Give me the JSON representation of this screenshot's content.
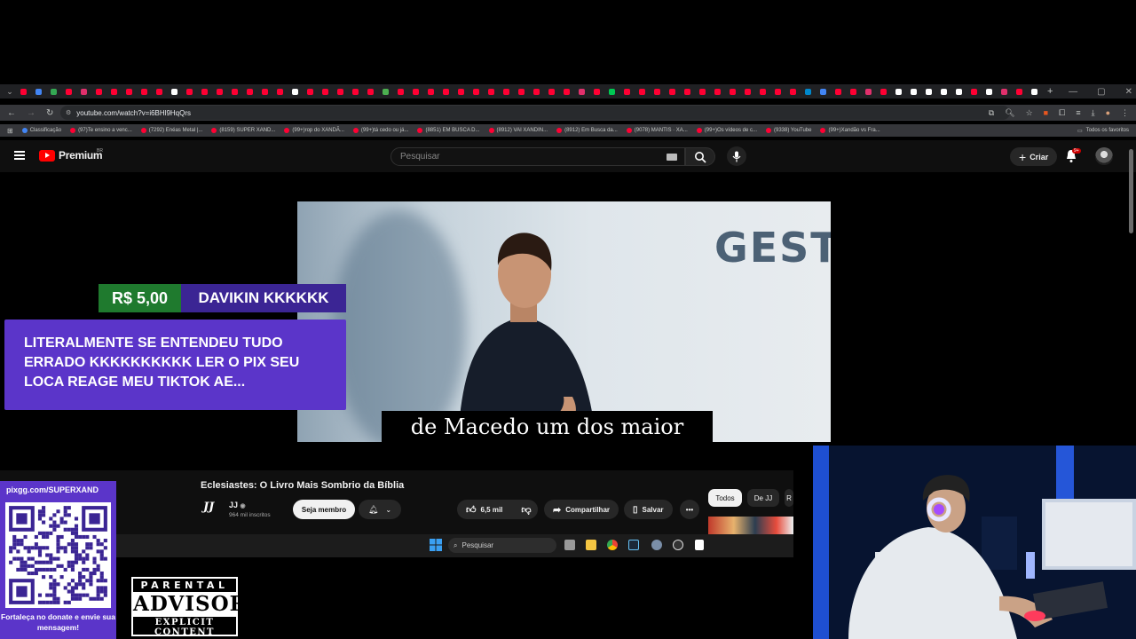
{
  "browser": {
    "url": "youtube.com/watch?v=i6BHl9HqQrs",
    "bookmarks": [
      "Classificação",
      "(97)Te ensino a venc...",
      "(7292) Enéas Metal |...",
      "(8159) SUPER XAND...",
      "(99+)rop do XANDÃ...",
      "(99+)tá cedo ou já...",
      "(8851) EM BUSCA D...",
      "(8912) VAI XANDIN...",
      "(8912) Em Busca da...",
      "(9078) MANTIS · XA...",
      "(99+)Os vídeos de c...",
      "(9338) YouTube",
      "(99+)Xandão vs Fra..."
    ],
    "all_bookmarks": "Todos os favoritos",
    "tab_colors": [
      "#ff0033",
      "#4285f4",
      "#34a853",
      "#ff0033",
      "#e1306c",
      "#ff0033",
      "#ff0033",
      "#ff0033",
      "#ff0033",
      "#ff0033",
      "#ffffff",
      "#ff0033",
      "#ff0033",
      "#ff0033",
      "#ff0033",
      "#ff0033",
      "#ff0033",
      "#ff0033",
      "#ffffff",
      "#ff0033",
      "#ff0033",
      "#ff0033",
      "#ff0033",
      "#ff0033",
      "#4caf50",
      "#ff0033",
      "#ff0033",
      "#ff0033",
      "#ff0033",
      "#ff0033",
      "#ff0033",
      "#ff0033",
      "#ff0033",
      "#ff0033",
      "#ff0033",
      "#ff0033",
      "#ff0033",
      "#e1306c",
      "#ff0033",
      "#00c853",
      "#ff0033",
      "#ff0033",
      "#ff0033",
      "#ff0033",
      "#ff0033",
      "#ff0033",
      "#ff0033",
      "#ff0033",
      "#ff0033",
      "#ff0033",
      "#ff0033",
      "#ff0033",
      "#0088cc",
      "#4285f4",
      "#ff0033",
      "#ff0033",
      "#e1306c",
      "#ff0033",
      "#ffffff",
      "#ffffff",
      "#ffffff",
      "#ffffff",
      "#ffffff",
      "#ff0033",
      "#ffffff",
      "#e1306c",
      "#ff0033",
      "#ffffff"
    ]
  },
  "youtube": {
    "logo_text": "Premium",
    "country": "BR",
    "search_placeholder": "Pesquisar",
    "create_label": "Criar",
    "notif_count": "9+",
    "video_title": "Eclesiastes: O Livro Mais Sombrio da Bíblia",
    "channel_name": "JJ",
    "channel_logo": "JJ",
    "subscribers": "964 mil inscritos",
    "member_button": "Seja membro",
    "likes": "6,5 mil",
    "share_label": "Compartilhar",
    "save_label": "Salvar",
    "chips": [
      "Todos",
      "De JJ",
      "R"
    ]
  },
  "video": {
    "on_screen_text": "GEST",
    "caption": "de Macedo um dos maior"
  },
  "donation": {
    "amount": "R$ 5,00",
    "name": "DAVIKIN KKKKKK",
    "message": "LITERALMENTE SE ENTENDEU TUDO ERRADO KKKKKKKKKK LER O PIX SEU LOCA REAGE MEU TIKTOK AE..."
  },
  "pix": {
    "url": "pixgg.com/SUPERXAND",
    "note": "Fortaleça no donate e envie sua mensagem!"
  },
  "advisory": {
    "top": "PARENTAL",
    "middle": "ADVISORY",
    "bottom": "EXPLICIT CONTENT"
  },
  "taskbar": {
    "search_label": "Pesquisar"
  }
}
